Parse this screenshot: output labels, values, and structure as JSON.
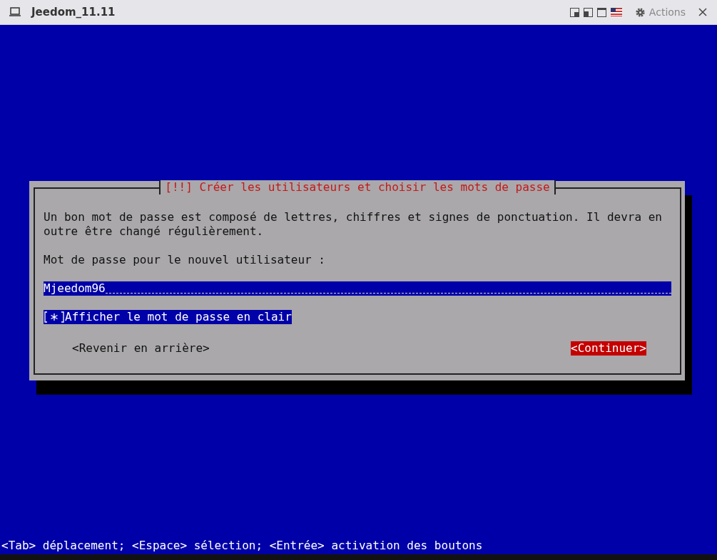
{
  "window": {
    "title": "Jeedom_11.11",
    "actions": "Actions"
  },
  "dialog": {
    "title": "[!!] Créer les utilisateurs et choisir les mots de passe",
    "description": "Un bon mot de passe est composé de lettres, chiffres et signes de ponctuation. Il devra en outre être changé régulièrement.",
    "field_label": "Mot de passe pour le nouvel utilisateur :",
    "password": {
      "value": "Mjeedom96"
    },
    "checkbox": {
      "label": "Afficher le mot de passe en clair",
      "checked": true
    },
    "buttons": [
      {
        "label": "<Revenir en arrière>",
        "selected": false
      },
      {
        "label": "<Continuer>",
        "selected": true
      }
    ]
  },
  "hint": "<Tab> déplacement; <Espace> sélection; <Entrée> activation des boutons"
}
